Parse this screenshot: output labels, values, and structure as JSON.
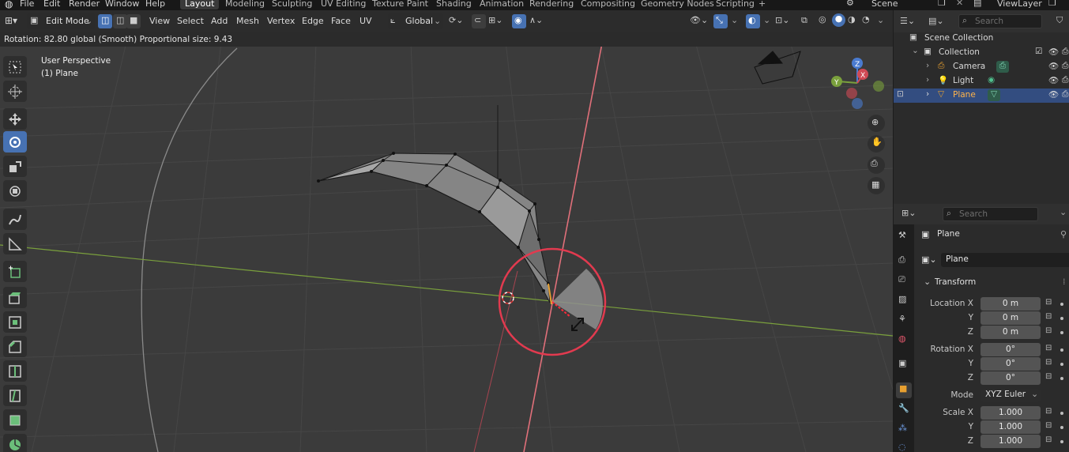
{
  "menu": {
    "items": [
      "File",
      "Edit",
      "Render",
      "Window",
      "Help"
    ],
    "workspaces": [
      "Layout",
      "Modeling",
      "Sculpting",
      "UV Editing",
      "Texture Paint",
      "Shading",
      "Animation",
      "Rendering",
      "Compositing",
      "Geometry Nodes",
      "Scripting"
    ],
    "active_workspace": "Layout",
    "add_tab_icon": "plus-icon",
    "scene_label": "Scene",
    "view_layer_label": "ViewLayer"
  },
  "viewport_header": {
    "mode": "Edit Mode",
    "menus": [
      "View",
      "Select",
      "Add",
      "Mesh",
      "Vertex",
      "Edge",
      "Face",
      "UV"
    ],
    "transform_orientation": "Global"
  },
  "status": {
    "operation_text": "Rotation: 82.80 global (Smooth) Proportional size: 9.43"
  },
  "overlay": {
    "view_name": "User Perspective",
    "object_name": "(1) Plane"
  },
  "gizmo": {
    "axis_z": "Z",
    "axis_y": "Y",
    "axis_x": "X"
  },
  "outliner": {
    "search_placeholder": "Search",
    "scene_collection": "Scene Collection",
    "items": [
      {
        "label": "Collection"
      },
      {
        "label": "Camera"
      },
      {
        "label": "Light"
      },
      {
        "label": "Plane"
      }
    ],
    "selected": "Plane"
  },
  "properties": {
    "search_placeholder": "Search",
    "object_name": "Plane",
    "data_name": "Plane",
    "panel_title": "Transform",
    "location": {
      "label": "Location X",
      "x": "0 m",
      "y": "0 m",
      "z": "0 m"
    },
    "rotation": {
      "label": "Rotation X",
      "x": "0°",
      "y": "0°",
      "z": "0°"
    },
    "mode_label": "Mode",
    "mode_value": "XYZ Euler",
    "scale": {
      "label": "Scale X",
      "x": "1.000",
      "y": "1.000",
      "z": "1.000"
    },
    "axis_y": "Y",
    "axis_z": "Z"
  },
  "colors": {
    "accent_blue": "#4772b3",
    "selection_row": "#334d80",
    "active_object_orange": "#e8a030",
    "x_axis_line": "#c94a55",
    "y_axis_line": "#7aa03c",
    "rotate_circle": "#e23a4f"
  }
}
